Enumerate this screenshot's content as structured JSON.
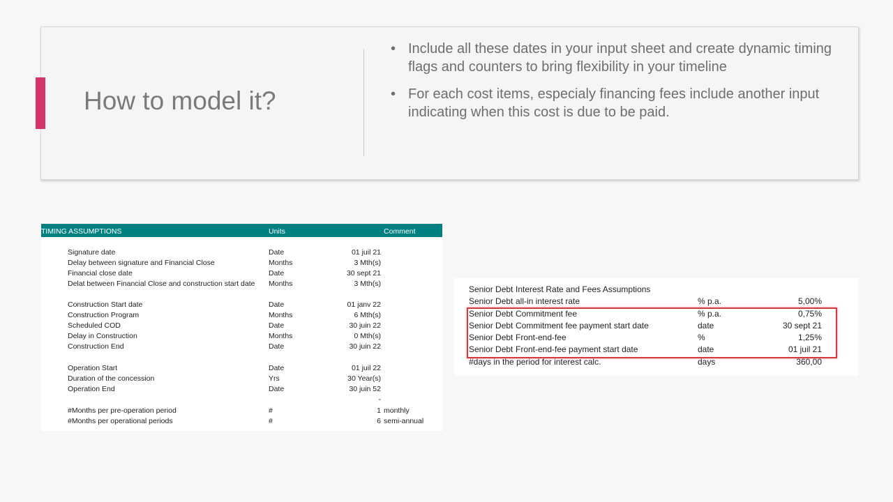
{
  "slide": {
    "title": "How to model it?",
    "bullets": [
      "Include all these dates in your input sheet and create dynamic timing flags and counters to bring flexibility in your timeline",
      "For each cost items, especialy financing fees include another input indicating when this cost is due to be paid."
    ],
    "bullet_char": "•",
    "accent_color": "#d6336c"
  },
  "timing_table": {
    "header": {
      "title": "TIMING ASSUMPTIONS",
      "units": "Units",
      "comment": "Comment"
    },
    "header_color": "#008080",
    "rows": [
      {
        "label": "Signature date",
        "unit": "Date",
        "value": "01 juil 21",
        "comment": ""
      },
      {
        "label": "Delay between signature and Financial Close",
        "unit": "Months",
        "value": "3 Mth(s)",
        "comment": ""
      },
      {
        "label": "Financial close date",
        "unit": "Date",
        "value": "30 sept 21",
        "comment": ""
      },
      {
        "label": "Delat between Financial Close and construction start date",
        "unit": "Months",
        "value": "3 Mth(s)",
        "comment": ""
      },
      {
        "label": "Construction Start date",
        "unit": "Date",
        "value": "01 janv 22",
        "comment": ""
      },
      {
        "label": "Construction Program",
        "unit": "Months",
        "value": "6 Mth(s)",
        "comment": ""
      },
      {
        "label": "Scheduled COD",
        "unit": "Date",
        "value": "30 juin 22",
        "comment": ""
      },
      {
        "label": "Delay in Construction",
        "unit": "Months",
        "value": "0 Mth(s)",
        "comment": ""
      },
      {
        "label": "Construction End",
        "unit": "Date",
        "value": "30 juin 22",
        "comment": ""
      },
      {
        "label": "Operation Start",
        "unit": "Date",
        "value": "01 juil 22",
        "comment": ""
      },
      {
        "label": "Duration of the concession",
        "unit": "Yrs",
        "value": "30 Year(s)",
        "comment": ""
      },
      {
        "label": "Operation End",
        "unit": "Date",
        "value": "30 juin 52",
        "comment": ""
      },
      {
        "label": "",
        "unit": "",
        "value": "-",
        "comment": ""
      },
      {
        "label": "#Months per pre-operation period",
        "unit": "#",
        "value": "1",
        "comment": "monthly"
      },
      {
        "label": "#Months per operational periods",
        "unit": "#",
        "value": "6",
        "comment": "semi-annual"
      }
    ]
  },
  "debt_table": {
    "rows": [
      {
        "a": "Senior Debt",
        "b": "Interest Rate and Fees Assumptions",
        "unit": "",
        "value": ""
      },
      {
        "a": "Senior Debt",
        "b": "all-in interest rate",
        "unit": "% p.a.",
        "value": "5,00%"
      },
      {
        "a": "Senior Debt",
        "b": "Commitment fee",
        "unit": "% p.a.",
        "value": "0,75%"
      },
      {
        "a": "Senior Debt",
        "b": "Commitment fee payment start date",
        "unit": "date",
        "value": "30 sept 21"
      },
      {
        "a": "Senior Debt",
        "b": "Front-end-fee",
        "unit": "%",
        "value": "1,25%"
      },
      {
        "a": "Senior Debt",
        "b": "Front-end-fee payment start date",
        "unit": "date",
        "value": "01 juil 21"
      },
      {
        "a": "#days in the period for interest calc.",
        "b": "",
        "unit": "days",
        "value": "360,00"
      }
    ],
    "highlight_color": "#d9383f"
  }
}
